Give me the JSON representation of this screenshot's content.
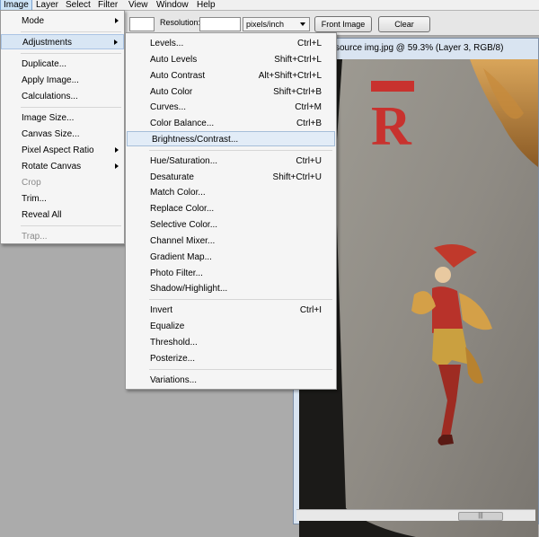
{
  "menubar": {
    "items": [
      "Image",
      "Layer",
      "Select",
      "Filter",
      "View",
      "Window",
      "Help"
    ]
  },
  "options_bar": {
    "resolution_label": "Resolution:",
    "unit_select": "pixels/inch",
    "front_image_label": "Front Image",
    "clear_label": "Clear"
  },
  "document": {
    "title": "source img.jpg @ 59.3% (Layer 3, RGB/8)",
    "card_letter": "R"
  },
  "image_menu": {
    "items": [
      {
        "label": "Mode",
        "submenu": true
      },
      {
        "label": "Adjustments",
        "submenu": true
      },
      {
        "label": "Duplicate..."
      },
      {
        "label": "Apply Image..."
      },
      {
        "label": "Calculations..."
      },
      {
        "label": "Image Size..."
      },
      {
        "label": "Canvas Size..."
      },
      {
        "label": "Pixel Aspect Ratio",
        "submenu": true
      },
      {
        "label": "Rotate Canvas",
        "submenu": true
      },
      {
        "label": "Crop",
        "disabled": true
      },
      {
        "label": "Trim..."
      },
      {
        "label": "Reveal All"
      },
      {
        "label": "Trap...",
        "disabled": true
      }
    ]
  },
  "adjustments_menu": {
    "items": [
      {
        "label": "Levels...",
        "shortcut": "Ctrl+L"
      },
      {
        "label": "Auto Levels",
        "shortcut": "Shift+Ctrl+L"
      },
      {
        "label": "Auto Contrast",
        "shortcut": "Alt+Shift+Ctrl+L"
      },
      {
        "label": "Auto Color",
        "shortcut": "Shift+Ctrl+B"
      },
      {
        "label": "Curves...",
        "shortcut": "Ctrl+M"
      },
      {
        "label": "Color Balance...",
        "shortcut": "Ctrl+B"
      },
      {
        "label": "Brightness/Contrast...",
        "shortcut": ""
      },
      {
        "label": "Hue/Saturation...",
        "shortcut": "Ctrl+U"
      },
      {
        "label": "Desaturate",
        "shortcut": "Shift+Ctrl+U"
      },
      {
        "label": "Match Color...",
        "shortcut": ""
      },
      {
        "label": "Replace Color...",
        "shortcut": ""
      },
      {
        "label": "Selective Color...",
        "shortcut": ""
      },
      {
        "label": "Channel Mixer...",
        "shortcut": ""
      },
      {
        "label": "Gradient Map...",
        "shortcut": ""
      },
      {
        "label": "Photo Filter...",
        "shortcut": ""
      },
      {
        "label": "Shadow/Highlight...",
        "shortcut": ""
      },
      {
        "label": "Invert",
        "shortcut": "Ctrl+I"
      },
      {
        "label": "Equalize",
        "shortcut": ""
      },
      {
        "label": "Threshold...",
        "shortcut": ""
      },
      {
        "label": "Posterize...",
        "shortcut": ""
      },
      {
        "label": "Variations...",
        "shortcut": ""
      }
    ]
  },
  "colors": {
    "menu_bg": "#f5f5f5",
    "highlight": "#d8e6f4",
    "card_red": "#c8322e"
  }
}
